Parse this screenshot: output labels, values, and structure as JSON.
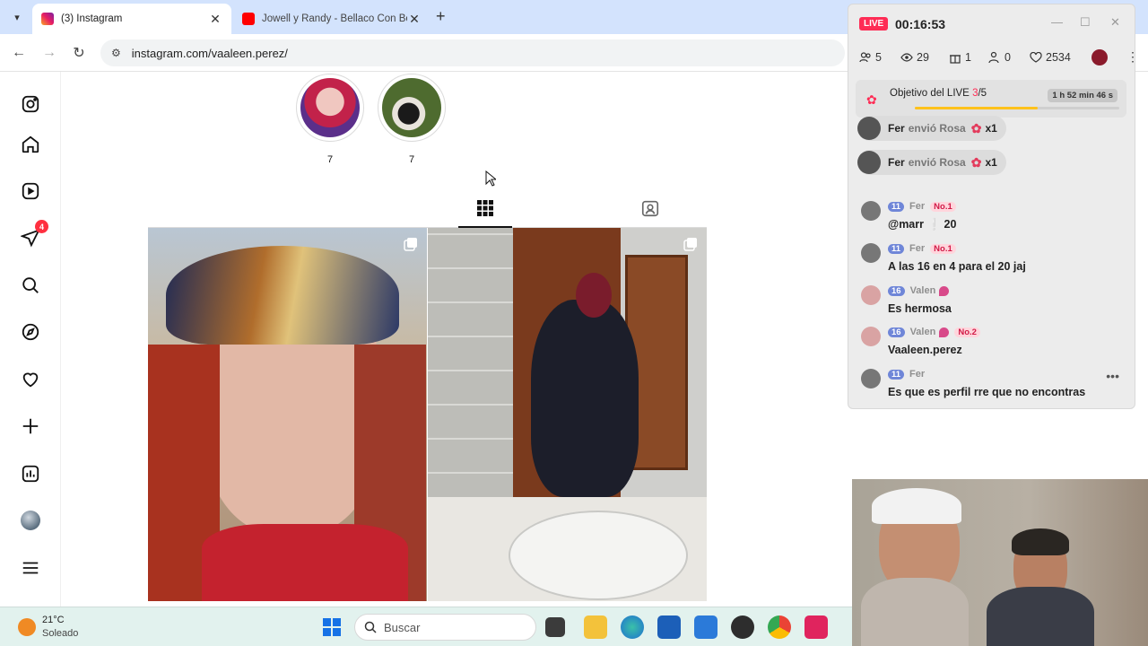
{
  "browser": {
    "tabs": [
      {
        "title": "(3) Instagram",
        "active": true
      },
      {
        "title": "Jowell y Randy - Bellaco Con Be",
        "active": false
      }
    ],
    "url": "instagram.com/vaaleen.perez/"
  },
  "instagram": {
    "sidebar_badge": "4",
    "highlights": [
      {
        "label": "7"
      },
      {
        "label": "7"
      }
    ]
  },
  "live": {
    "badge": "LIVE",
    "timer": "00:16:53",
    "stats": {
      "members": "5",
      "viewers": "29",
      "gifts": "1",
      "joins": "0",
      "likes": "2534"
    },
    "goal": {
      "title": "Objetivo del LIVE",
      "count": "3",
      "total": "/5",
      "timer": "1 h 52 min 46 s",
      "progress": 0.6
    },
    "gift_events": [
      {
        "user": "Fer",
        "action": "envió Rosa",
        "qty": "x1"
      },
      {
        "user": "Fer",
        "action": "envió Rosa",
        "qty": "x1"
      }
    ],
    "messages": [
      {
        "level": "11",
        "user": "Fer",
        "rank": "No.1",
        "text": "@marr ❕ 20"
      },
      {
        "level": "11",
        "user": "Fer",
        "rank": "No.1",
        "text": "A las 16 en 4 para el 20 jaj"
      },
      {
        "level": "16",
        "user": "Valen",
        "rank": "",
        "text": "Es hermosa"
      },
      {
        "level": "16",
        "user": "Valen",
        "rank": "No.2",
        "text": "Vaaleen.perez"
      },
      {
        "level": "11",
        "user": "Fer",
        "rank": "",
        "text": "Es que es perfil rre que no encontras"
      }
    ]
  },
  "taskbar": {
    "temperature": "21°C",
    "weather": "Soleado",
    "search_placeholder": "Buscar"
  },
  "colors": {
    "tiktok_red": "#fe2c55",
    "goal_fill": "#ffc21c",
    "tab_bar": "#d3e3fd",
    "taskbar": "#e2f2ee"
  }
}
